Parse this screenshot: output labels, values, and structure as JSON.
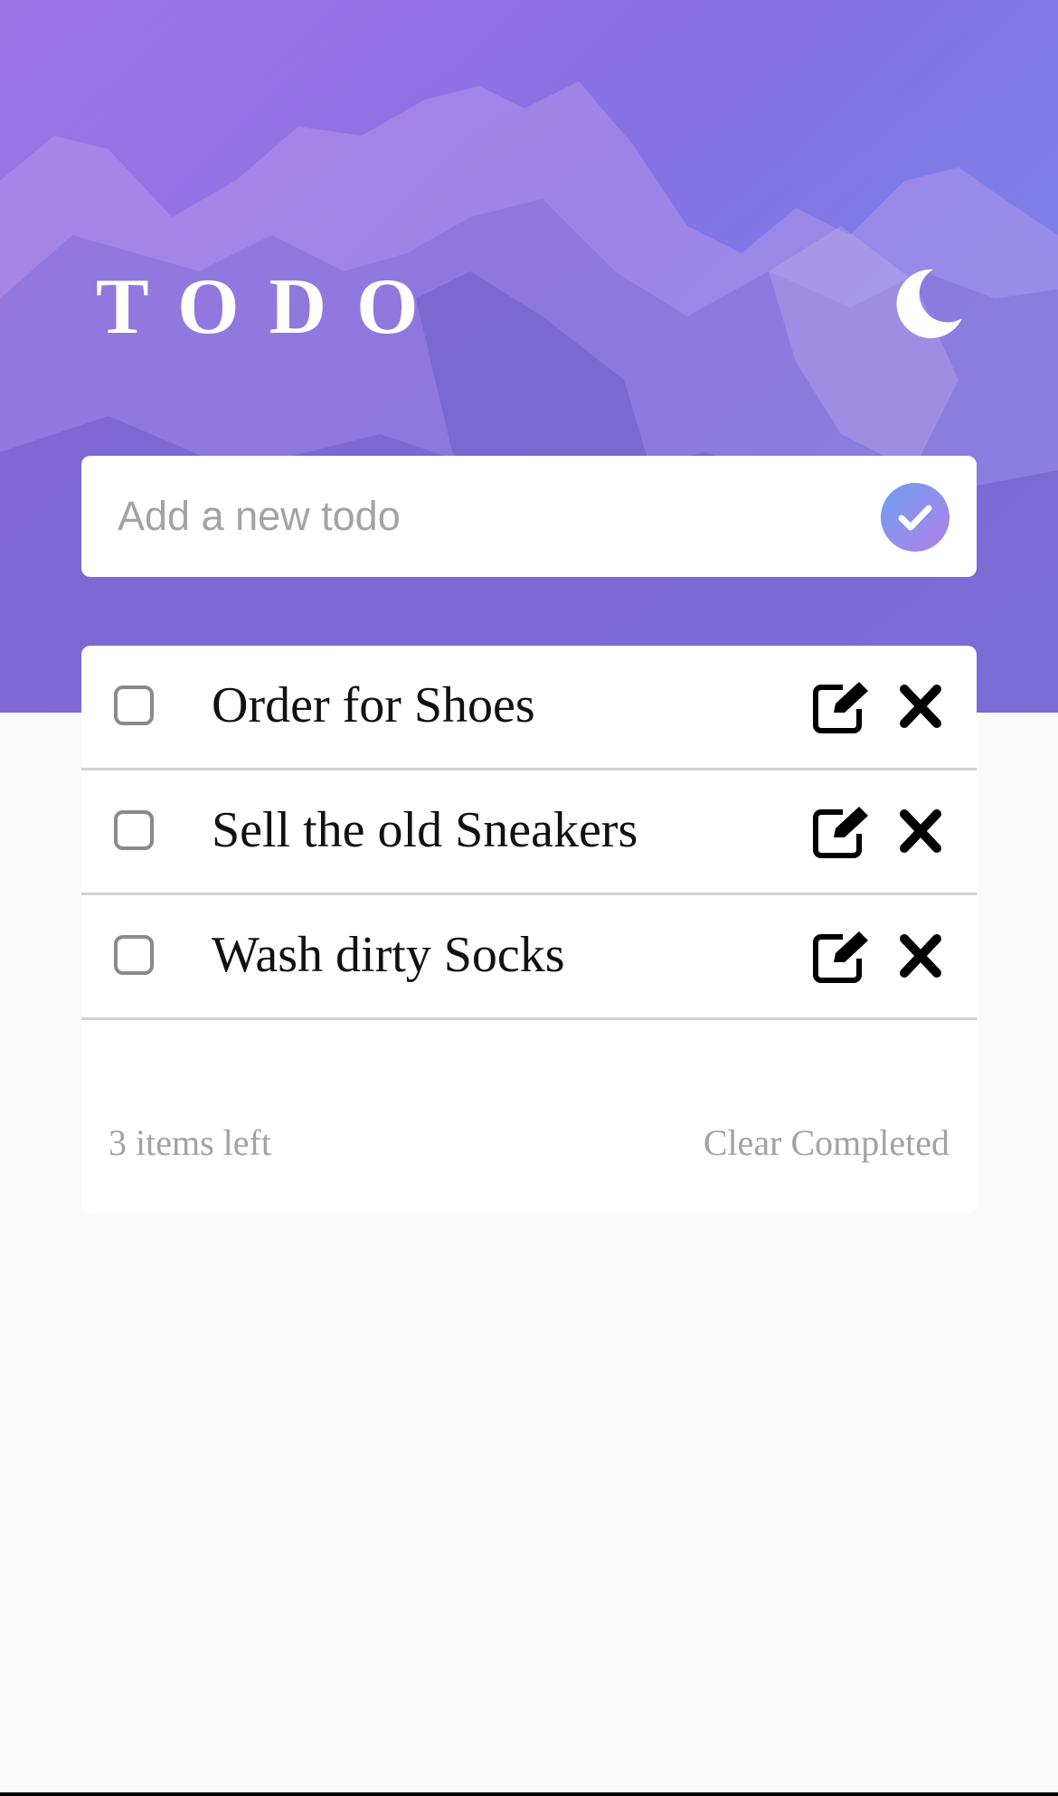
{
  "header": {
    "title": "TODO",
    "theme_toggle_icon": "moon-icon"
  },
  "new_todo": {
    "placeholder": "Add a new todo",
    "value": "",
    "submit_icon": "check-icon"
  },
  "todos": [
    {
      "text": "Order for Shoes",
      "completed": false
    },
    {
      "text": "Sell the old Sneakers",
      "completed": false
    },
    {
      "text": "Wash dirty Socks",
      "completed": false
    }
  ],
  "footer": {
    "items_left": "3 items left",
    "clear_completed": "Clear Completed"
  },
  "colors": {
    "hero_gradient": [
      "#9a6de3",
      "#7b5ee0",
      "#6f86e8"
    ],
    "submit_gradient": [
      "#6ea0f2",
      "#b07fe6"
    ],
    "page_background": "#fafafa",
    "muted_text": "#a2a2a2"
  },
  "icons": {
    "edit": "edit-icon",
    "delete": "close-icon",
    "checkbox": "checkbox-icon"
  }
}
